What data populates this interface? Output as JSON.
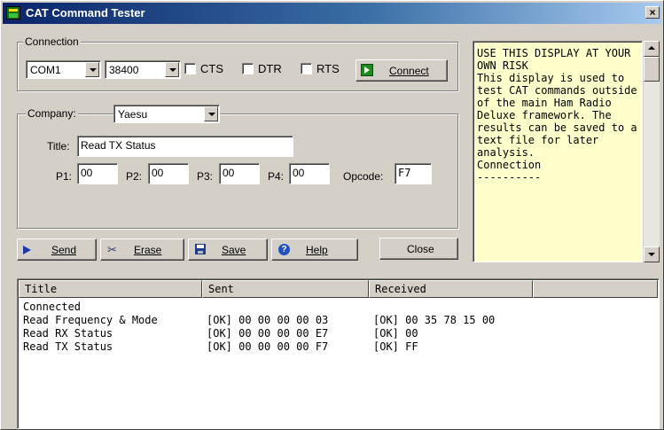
{
  "window": {
    "title": "CAT Command Tester",
    "close_glyph": "×"
  },
  "connection": {
    "legend": "Connection",
    "port": "COM1",
    "baud": "38400",
    "cts_label": "CTS",
    "dtr_label": "DTR",
    "rts_label": "RTS",
    "connect_label": "Connect"
  },
  "company": {
    "legend": "Company:",
    "selected": "Yaesu",
    "title_label": "Title:",
    "title_value": "Read TX Status",
    "p1_label": "P1:",
    "p1_value": "00",
    "p2_label": "P2:",
    "p2_value": "00",
    "p3_label": "P3:",
    "p3_value": "00",
    "p4_label": "P4:",
    "p4_value": "00",
    "opcode_label": "Opcode:",
    "opcode_value": "F7"
  },
  "info_text": [
    "USE THIS DISPLAY AT YOUR OWN RISK",
    "",
    "This display is used to test CAT commands outside of the main Ham Radio Deluxe framework. The results can be saved to a text file for later analysis.",
    "",
    "Connection",
    "----------"
  ],
  "buttons": {
    "send": "Send",
    "erase": "Erase",
    "save": "Save",
    "help": "Help",
    "close": "Close"
  },
  "log": {
    "columns": [
      "Title",
      "Sent",
      "Received",
      ""
    ],
    "rows": [
      {
        "title": "Connected",
        "sent": "",
        "received": ""
      },
      {
        "title": "Read Frequency & Mode",
        "sent": "[OK] 00 00 00 00 03",
        "received": "[OK] 00 35 78 15 00"
      },
      {
        "title": "Read RX Status",
        "sent": "[OK] 00 00 00 00 E7",
        "received": "[OK] 00"
      },
      {
        "title": "Read TX Status",
        "sent": "[OK] 00 00 00 00 F7",
        "received": "[OK] FF"
      }
    ]
  }
}
